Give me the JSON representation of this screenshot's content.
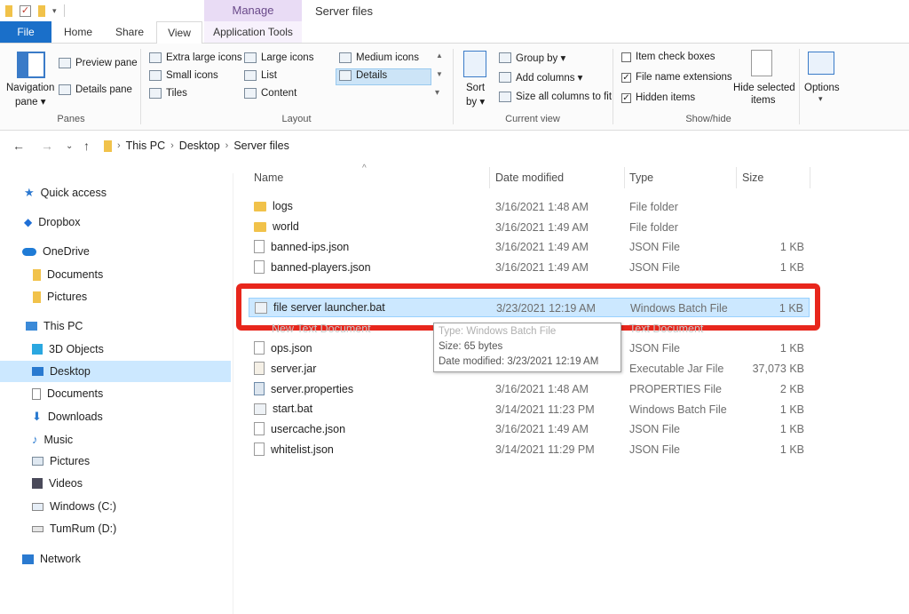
{
  "window": {
    "title": "Server files",
    "manage_tab": "Manage"
  },
  "tabs": {
    "file": "File",
    "home": "Home",
    "share": "Share",
    "view": "View",
    "app_tools": "Application Tools"
  },
  "ribbon": {
    "panes": {
      "label": "Panes",
      "navigation_pane": "Navigation",
      "navigation_pane2": "pane ▾",
      "preview_pane": "Preview pane",
      "details_pane": "Details pane"
    },
    "layout": {
      "label": "Layout",
      "extra_large": "Extra large icons",
      "large": "Large icons",
      "medium": "Medium icons",
      "small": "Small icons",
      "list": "List",
      "details": "Details",
      "tiles": "Tiles",
      "content": "Content"
    },
    "current_view": {
      "label": "Current view",
      "sort_by": "Sort",
      "sort_by2": "by ▾",
      "group_by": "Group by ▾",
      "add_columns": "Add columns ▾",
      "size_all": "Size all columns to fit"
    },
    "show_hide": {
      "label": "Show/hide",
      "item_check_boxes": "Item check boxes",
      "file_name_extensions": "File name extensions",
      "hidden_items": "Hidden items",
      "hide_selected": "Hide selected",
      "hide_selected2": "items",
      "options": "Options"
    }
  },
  "address": {
    "crumbs": [
      "This PC",
      "Desktop",
      "Server files"
    ]
  },
  "nav": {
    "quick_access": "Quick access",
    "dropbox": "Dropbox",
    "onedrive": "OneDrive",
    "documents_od": "Documents",
    "pictures_od": "Pictures",
    "this_pc": "This PC",
    "objects3d": "3D Objects",
    "desktop": "Desktop",
    "documents": "Documents",
    "downloads": "Downloads",
    "music": "Music",
    "pictures": "Pictures",
    "videos": "Videos",
    "windows_c": "Windows (C:)",
    "tumrum_d": "TumRum (D:)",
    "network": "Network"
  },
  "columns": {
    "name": "Name",
    "date": "Date modified",
    "type": "Type",
    "size": "Size"
  },
  "files": [
    {
      "name": "logs",
      "date": "3/16/2021 1:48 AM",
      "type": "File folder",
      "size": ""
    },
    {
      "name": "world",
      "date": "3/16/2021 1:49 AM",
      "type": "File folder",
      "size": ""
    },
    {
      "name": "banned-ips.json",
      "date": "3/16/2021 1:49 AM",
      "type": "JSON File",
      "size": "1 KB"
    },
    {
      "name": "banned-players.json",
      "date": "3/16/2021 1:49 AM",
      "type": "JSON File",
      "size": "1 KB"
    },
    {
      "name": "file server launcher.bat",
      "date": "3/23/2021 12:19 AM",
      "type": "Windows Batch File",
      "size": "1 KB"
    },
    {
      "name": "ops.json",
      "date": "",
      "type": "JSON File",
      "size": "1 KB"
    },
    {
      "name": "server.jar",
      "date": "",
      "type": "Executable Jar File",
      "size": "37,073 KB"
    },
    {
      "name": "server.properties",
      "date": "3/16/2021 1:48 AM",
      "type": "PROPERTIES File",
      "size": "2 KB"
    },
    {
      "name": "start.bat",
      "date": "3/14/2021 11:23 PM",
      "type": "Windows Batch File",
      "size": "1 KB"
    },
    {
      "name": "usercache.json",
      "date": "3/16/2021 1:49 AM",
      "type": "JSON File",
      "size": "1 KB"
    },
    {
      "name": "whitelist.json",
      "date": "3/14/2021 11:29 PM",
      "type": "JSON File",
      "size": "1 KB"
    }
  ],
  "tooltip": {
    "line1": "Type: Windows Batch File",
    "line2": "Size: 65 bytes",
    "line3": "Date modified: 3/23/2021 12:19 AM"
  },
  "ghost_text": {
    "new_text_doc": "New Text Document",
    "text_document": "Text Document"
  }
}
